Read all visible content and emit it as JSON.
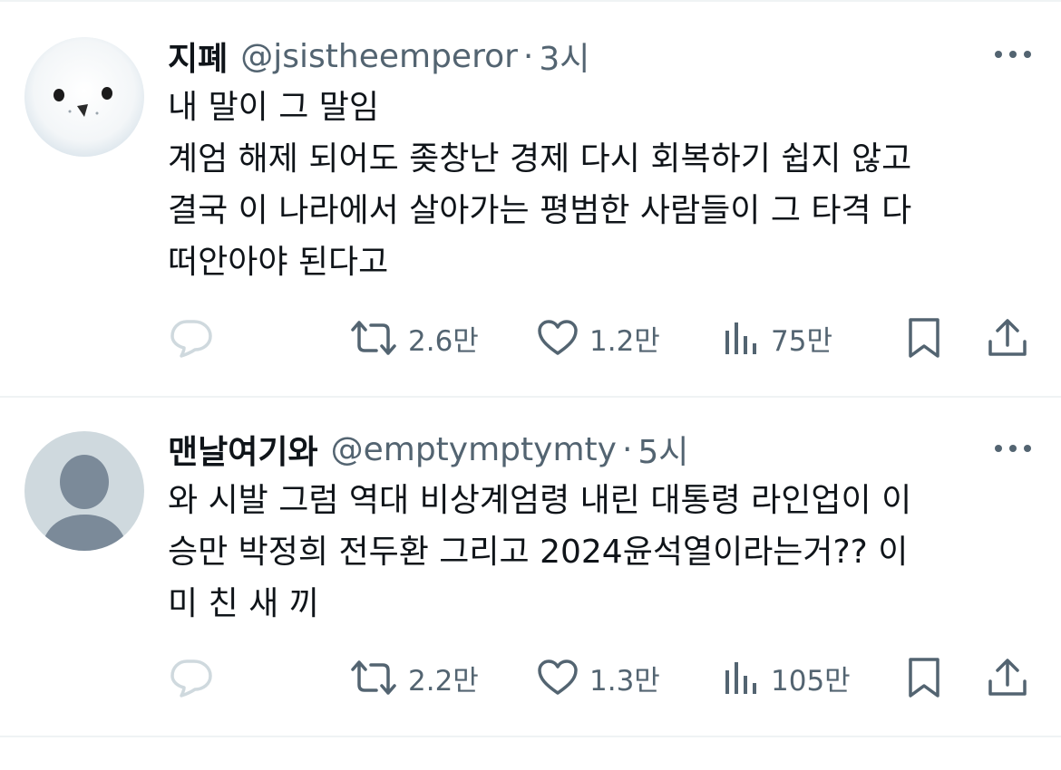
{
  "tweets": [
    {
      "display_name": "지폐",
      "handle": "@jsistheemperor",
      "separator": "·",
      "time": "3시",
      "lines": [
        "내 말이 그 말임",
        "계엄 해제 되어도 좆창난 경제 다시 회복하기 쉽지 않고",
        "결국 이 나라에서 살아가는 평범한 사람들이 그 타격 다",
        "떠안아야 된다고"
      ],
      "avatar_icon": "white-bird-avatar",
      "reply_icon": "reply-icon",
      "retweets": "2.6만",
      "likes": "1.2만",
      "views": "75만"
    },
    {
      "display_name": "맨날여기와",
      "handle": "@emptymptymty",
      "separator": "·",
      "time": "5시",
      "lines": [
        "와 시발 그럼 역대 비상계엄령 내린 대통령 라인업이 이",
        "승만 박정희 전두환 그리고 2024윤석열이라는거?? 이",
        "미 친 새 끼"
      ],
      "avatar_icon": "default-user-avatar",
      "reply_icon": "reply-icon",
      "retweets": "2.2만",
      "likes": "1.3만",
      "views": "105만"
    }
  ],
  "colors": {
    "text": "#0f1419",
    "secondary": "#536471",
    "divider": "#eff3f4",
    "reply_icon": "#cfd9de",
    "default_avatar_bg": "#cfd9de",
    "default_avatar_fg": "#7b8a99"
  }
}
